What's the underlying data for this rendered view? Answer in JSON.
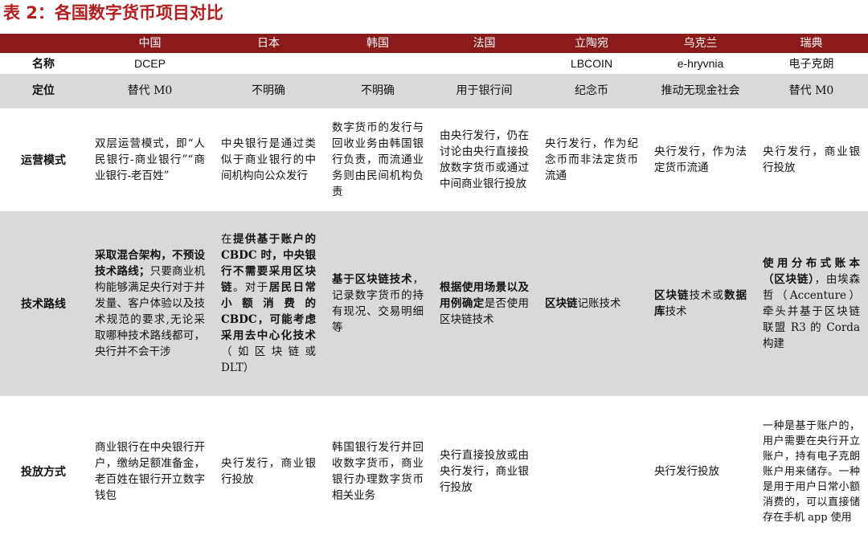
{
  "title": "表 2：各国数字货币项目对比",
  "header": [
    "中国",
    "日本",
    "韩国",
    "法国",
    "立陶宛",
    "乌克兰",
    "瑞典"
  ],
  "row_labels": {
    "name": "名称",
    "position": "定位",
    "operation": "运营模式",
    "technology": "技术路线",
    "issuance": "投放方式"
  },
  "name_row": [
    "DCEP",
    "",
    "",
    "",
    "LBCOIN",
    "e-hryvnia",
    "电子克朗"
  ],
  "position_row": [
    "替代 M0",
    "不明确",
    "不明确",
    "用于银行间",
    "纪念币",
    "推动无现金社会",
    "替代 M0"
  ],
  "operation_row": [
    "双层运营模式，即“人民银行-商业银行”“商业银行-老百姓”",
    "中央银行是通过类似于商业银行的中间机构向公众发行",
    "数字货币的发行与回收业务由韩国银行负责，而流通业务则由民间机构负责",
    "由央行发行，仍在讨论由央行直接投放数字货币或通过中间商业银行投放",
    "央行发行，作为纪念币而非法定货币流通",
    "央行发行，作为法定货币流通",
    "央行发行，商业银行投放"
  ],
  "technology_row": [
    {
      "bold": "采取混合架构，不预设技术路线；",
      "rest": "只要商业机构能够满足央行对于并发量、客户体验以及技术规范的要求,无论采取哪种技术路线都可，央行并不会干涉"
    },
    {
      "pre": "在",
      "bold": "提供基于账户的 CBDC 时，中央银行不需要采用区块链",
      "mid": "。对于",
      "bold2": "居民日常小额消费的 CBDC，可能考虑采用去中心化技术",
      "rest": "（如区块链或 DLT）"
    },
    {
      "bold": "基于区块链技术",
      "rest": "，记录数字货币的持有现况、交易明细等"
    },
    {
      "bold": "根据使用场景以及用例确定",
      "rest": "是否使用区块链技术"
    },
    {
      "bold": "区块链",
      "rest": "记账技术"
    },
    {
      "bold": "区块链",
      "mid": "技术或",
      "bold2": "数据库",
      "rest": "技术"
    },
    {
      "bold": "使用分布式账本（区块链）",
      "rest": "，由埃森哲（Accenture）牵头并基于区块链联盟 R3 的 Corda 构建"
    }
  ],
  "issuance_row": [
    "商业银行在中央银行开户，缴纳足额准备金，老百姓在银行开立数字钱包",
    "央行发行，商业银行投放",
    "韩国银行发行并回收数字货币，商业银行办理数字货币相关业务",
    "央行直接投放或由央行发行，商业银行投放",
    "",
    "央行发行投放",
    "一种是基于账户的，用户需要在央行开立账户，持有电子克朗账户用来储存。一种是用于用户日常小额消费的，可以直接储存在手机 app 使用"
  ],
  "colors": {
    "title": "#b51e1e",
    "header_bg": "#8b1a1a",
    "band": "#d9d9d9"
  }
}
